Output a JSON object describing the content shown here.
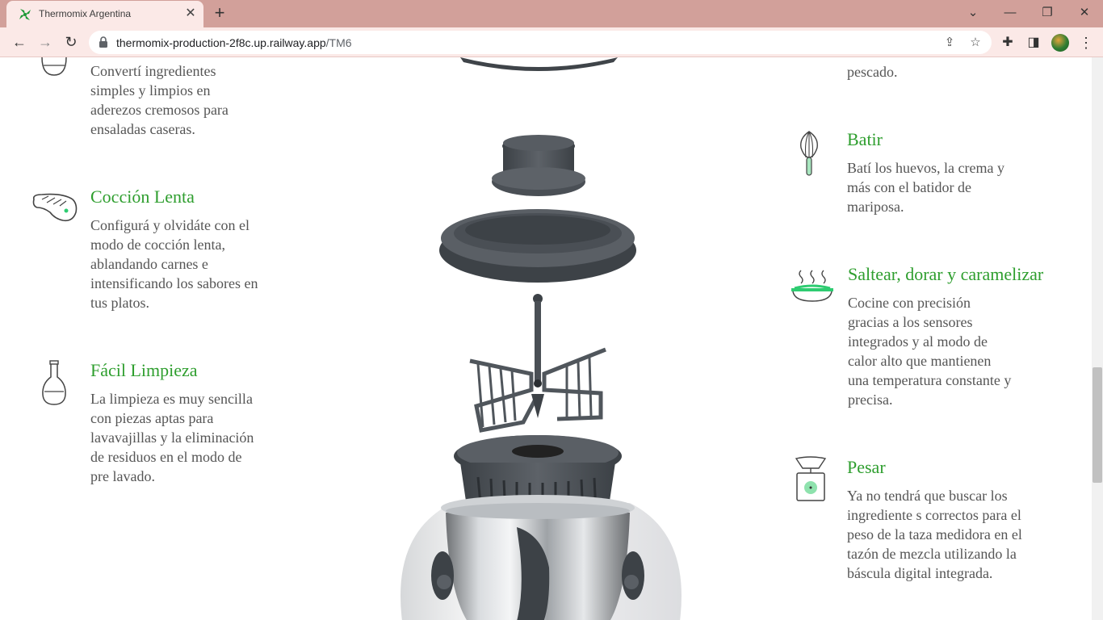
{
  "browser": {
    "tab": {
      "title": "Thermomix Argentina"
    },
    "new_tab_label": "+",
    "url_host": "thermomix-production-2f8c.up.railway.app",
    "url_path": "/TM6"
  },
  "features_left": [
    {
      "title": "",
      "text": "Convertí ingredientes simples y limpios en aderezos cremosos para ensaladas caseras.",
      "icon": "dressing-bowl-icon"
    },
    {
      "title": "Cocción Lenta",
      "text": "Configurá y olvidáte con el modo de cocción lenta, ablandando carnes e intensificando los sabores en tus platos.",
      "icon": "steak-icon"
    },
    {
      "title": "Fácil Limpieza",
      "text": "La limpieza es muy sencilla con piezas aptas para lavavajillas y la eliminación de residuos en el modo de pre lavado.",
      "icon": "flask-icon"
    }
  ],
  "features_right": [
    {
      "title": "",
      "text": "pescado.",
      "icon": ""
    },
    {
      "title": "Batir",
      "text": "Batí los huevos, la crema y más con el batidor de mariposa.",
      "icon": "whisk-icon"
    },
    {
      "title": "Saltear, dorar y caramelizar",
      "text": "Cocine con precisión gracias a los sensores integrados y al modo de calor alto que mantienen una temperatura constante y precisa.",
      "icon": "steaming-pan-icon"
    },
    {
      "title": "Pesar",
      "text": "Ya no tendrá que buscar los ingrediente s correctos para el peso de la taza medidora en el tazón de mezcla utilizando la báscula digital integrada.",
      "icon": "scale-icon"
    }
  ],
  "colors": {
    "accent": "#2e9e2e",
    "tab_strip": "#d2a09a",
    "toolbar": "#fbe9e7"
  }
}
